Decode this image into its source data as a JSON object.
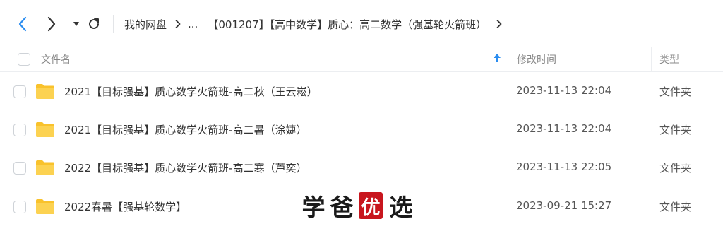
{
  "toolbar": {
    "breadcrumb": {
      "root": "我的网盘",
      "ellipsis": "...",
      "current": "【001207】【高中数学】质心：高二数学（强基轮火箭班）"
    }
  },
  "table": {
    "headers": {
      "name": "文件名",
      "time": "修改时间",
      "type": "类型"
    },
    "rows": [
      {
        "name": "2021【目标强基】质心数学火箭班-高二秋（王云崧）",
        "time": "2023-11-13 22:04",
        "type": "文件夹"
      },
      {
        "name": "2021【目标强基】质心数学火箭班-高二暑（涂婕）",
        "time": "2023-11-13 22:04",
        "type": "文件夹"
      },
      {
        "name": "2022【目标强基】质心数学火箭班-高二寒（芦奕）",
        "time": "2023-11-13 22:05",
        "type": "文件夹"
      },
      {
        "name": "2022春暑【强基轮数学】",
        "time": "2023-09-21 15:27",
        "type": "文件夹"
      }
    ]
  },
  "watermark": {
    "chars": [
      "学",
      "爸",
      "优",
      "选"
    ]
  },
  "colors": {
    "accent": "#2b8df0",
    "folder": "#f9c22c",
    "seal": "#c8161e"
  },
  "icons": [
    "back-arrow-icon",
    "forward-arrow-icon",
    "dropdown-icon",
    "refresh-icon",
    "chevron-right-icon",
    "sort-up-icon",
    "folder-icon"
  ]
}
